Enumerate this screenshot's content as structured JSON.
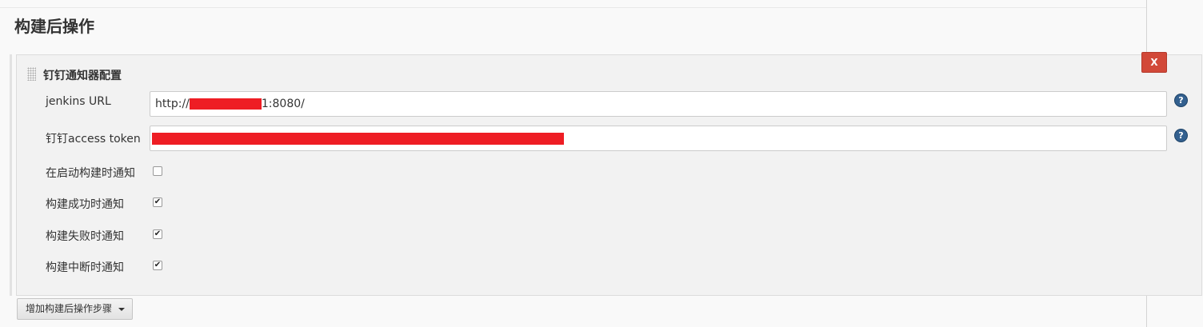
{
  "section": {
    "title": "构建后操作"
  },
  "panel": {
    "title": "钉钉通知器配置",
    "delete_label": "X",
    "fields": [
      {
        "label": "jenkins URL",
        "value_prefix": "http://",
        "value_suffix": "1:8080/"
      },
      {
        "label": "钉钉access token",
        "value": ""
      }
    ],
    "help_glyph": "?",
    "checkboxes": [
      {
        "label": "在启动构建时通知",
        "checked": false
      },
      {
        "label": "构建成功时通知",
        "checked": true
      },
      {
        "label": "构建失败时通知",
        "checked": true
      },
      {
        "label": "构建中断时通知",
        "checked": true
      }
    ],
    "check_glyph": "✔"
  },
  "add_step": {
    "label": "增加构建后操作步骤"
  },
  "colors": {
    "delete": "#d24939",
    "redaction": "#ee1d24",
    "help": "#33608f"
  },
  "icons": [
    "drag-handle-icon",
    "help-icon",
    "checkmark-icon",
    "caret-down-icon"
  ]
}
